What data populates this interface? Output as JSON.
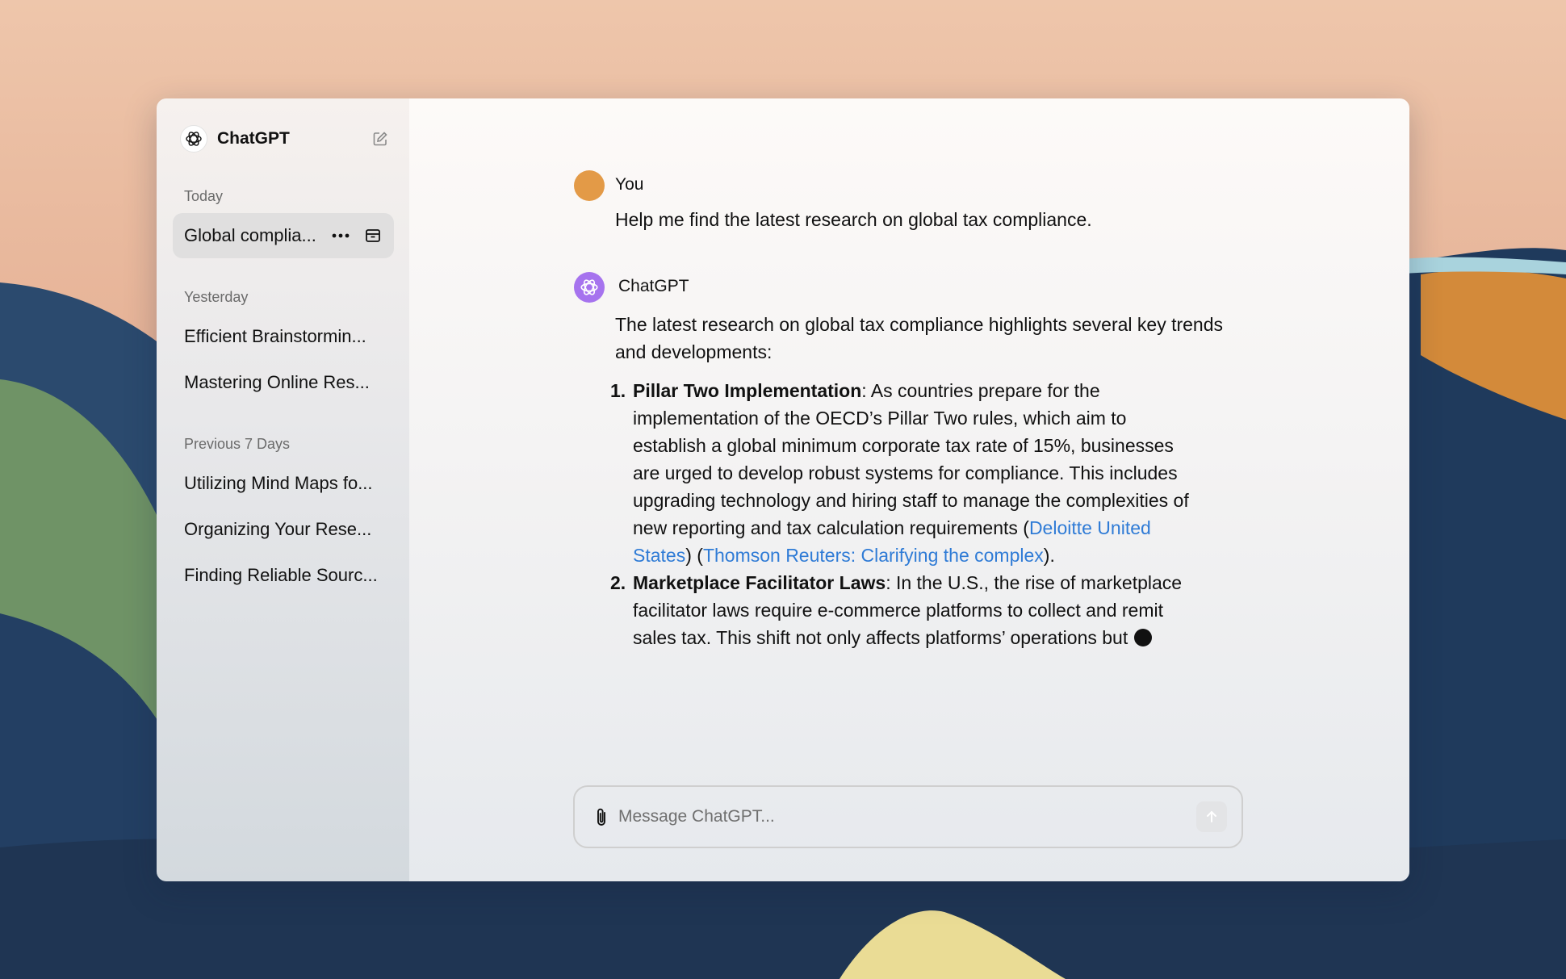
{
  "theme": {
    "accent_link": "#2f7bd6",
    "user_avatar": "#e39a47",
    "assistant_avatar": "#a673ee",
    "active_item_bg": "#e0dfdf"
  },
  "sidebar": {
    "title": "ChatGPT",
    "logo_icon": "openai-logo-icon",
    "new_chat_icon": "compose-icon",
    "sections": [
      {
        "heading": "Today",
        "items": [
          {
            "label": "Global complia...",
            "active": true
          }
        ]
      },
      {
        "heading": "Yesterday",
        "items": [
          {
            "label": "Efficient Brainstormin..."
          },
          {
            "label": "Mastering Online Res..."
          }
        ]
      },
      {
        "heading": "Previous 7 Days",
        "items": [
          {
            "label": "Utilizing Mind Maps fo..."
          },
          {
            "label": "Organizing Your Rese..."
          },
          {
            "label": "Finding Reliable Sourc..."
          }
        ]
      }
    ],
    "item_actions": [
      "more-options-icon",
      "archive-icon"
    ]
  },
  "conversation": {
    "user": {
      "name": "You",
      "message": "Help me find the latest research on global tax compliance."
    },
    "assistant": {
      "name": "ChatGPT",
      "intro": "The latest research on global tax compliance highlights several key trends and developments:",
      "points": [
        {
          "number": "1.",
          "title": "Pillar Two Implementation",
          "text": ": As countries prepare for the implementation of the OECD’s Pillar Two rules, which aim to establish a global minimum corporate tax rate of 15%, businesses are urged to develop robust systems for compliance. This includes upgrading technology and hiring staff to manage the complexities of new reporting and tax calculation requirements (",
          "link1": "Deloitte United States",
          "between": ") (",
          "link2": "Thomson Reuters: Clarifying the complex",
          "end": ")."
        },
        {
          "number": "2.",
          "title": "Marketplace Facilitator Laws",
          "text": ": In the U.S., the rise of marketplace facilitator laws require e-commerce platforms to collect and remit sales tax. This shift not only affects platforms’ operations but"
        }
      ]
    }
  },
  "composer": {
    "placeholder": "Message ChatGPT...",
    "value": "",
    "attach_icon": "paperclip-icon",
    "send_icon": "arrow-up-icon"
  }
}
